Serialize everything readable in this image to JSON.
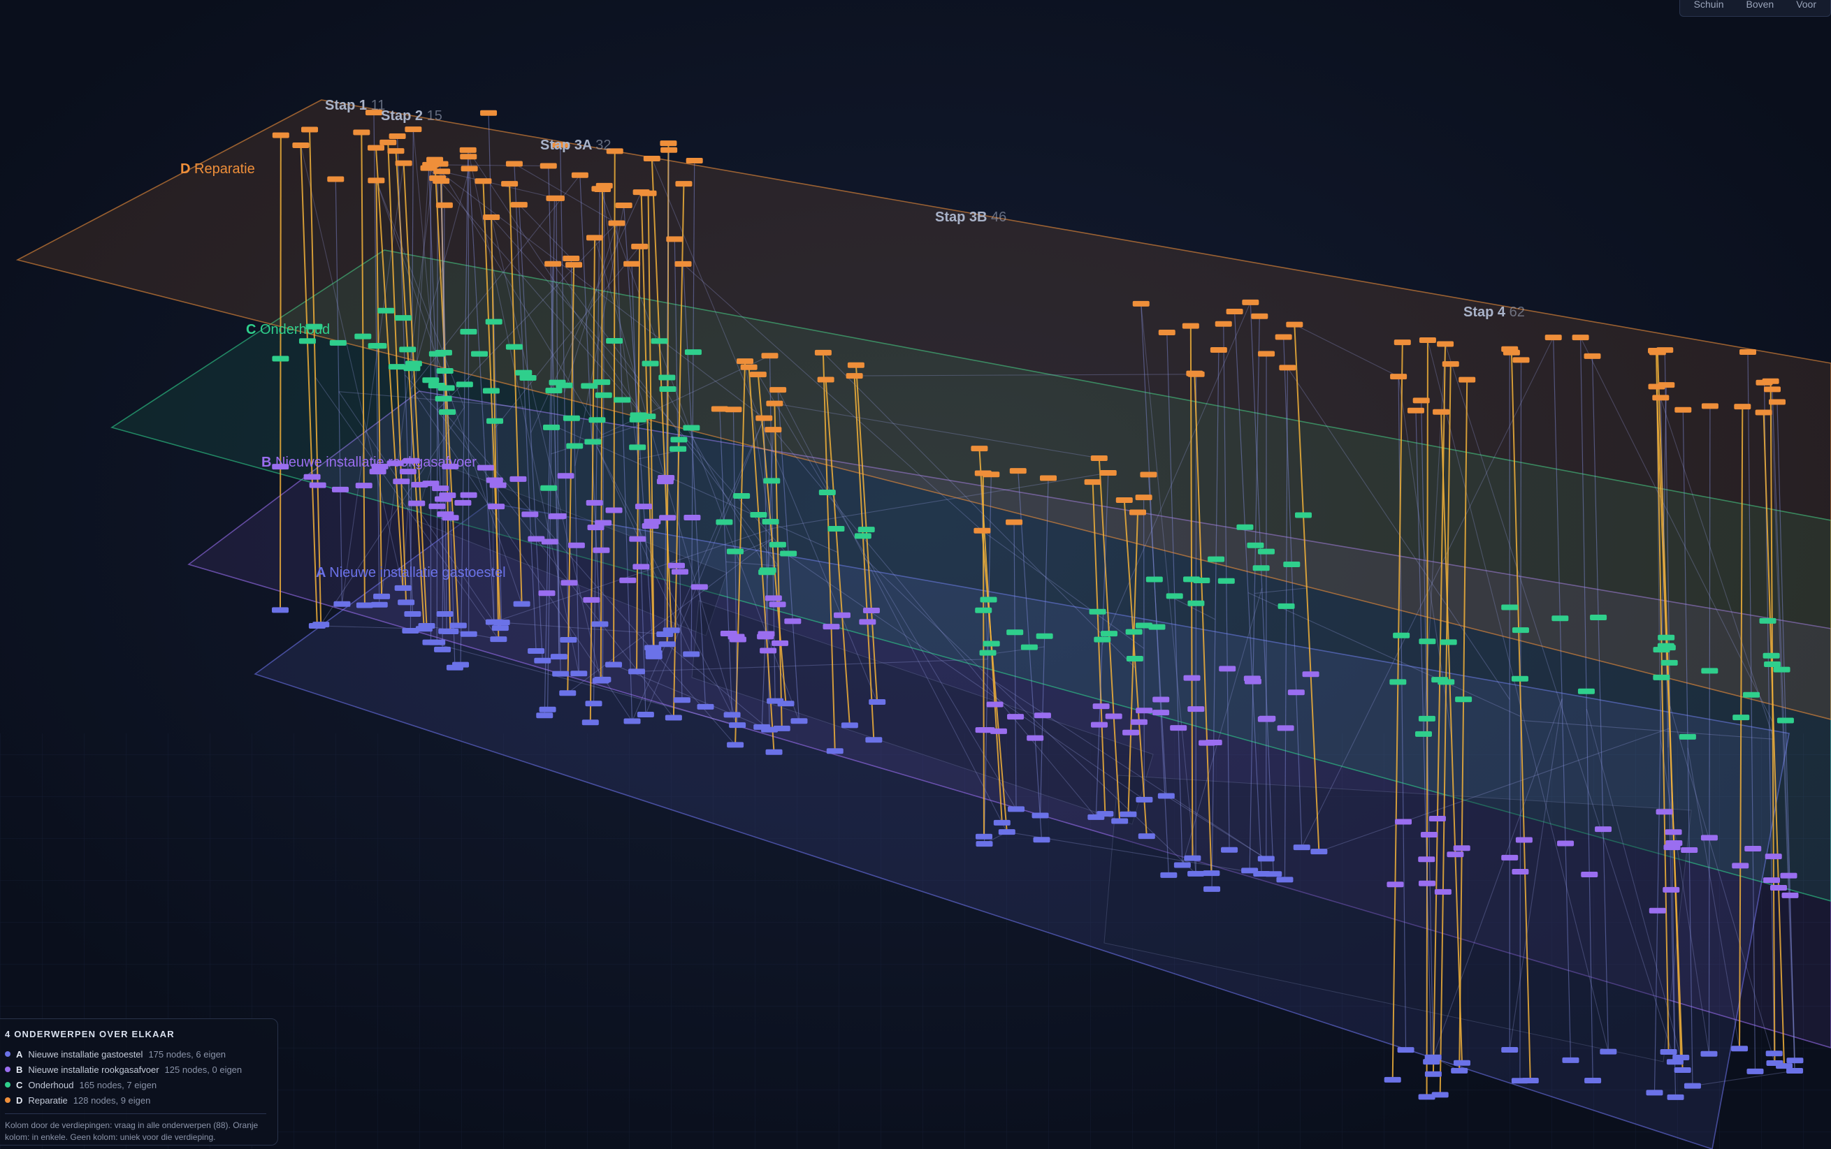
{
  "view_controls": [
    "Schuin",
    "Boven",
    "Voor"
  ],
  "colors": {
    "A": "#6b72e8",
    "B": "#9a6ef0",
    "C": "#2fcf8c",
    "D": "#ef8f3a",
    "stage_label": "#a9b3c9"
  },
  "layers": [
    {
      "letter": "A",
      "name": "Nieuwe installatie gastoestel"
    },
    {
      "letter": "B",
      "name": "Nieuwe installatie rookgasafvoer"
    },
    {
      "letter": "C",
      "name": "Onderhoud"
    },
    {
      "letter": "D",
      "name": "Reparatie"
    }
  ],
  "stages": [
    {
      "name": "Stap 1",
      "count": "11"
    },
    {
      "name": "Stap 2",
      "count": "15"
    },
    {
      "name": "Stap 3A",
      "count": "32"
    },
    {
      "name": "Stap 3B",
      "count": "46"
    },
    {
      "name": "Stap 4",
      "count": "62"
    }
  ],
  "legend": {
    "title": "4 onderwerpen over elkaar",
    "items": [
      {
        "letter": "A",
        "name": "Nieuwe installatie gastoestel",
        "count": "175 nodes, 6 eigen",
        "color": "#6b72e8"
      },
      {
        "letter": "B",
        "name": "Nieuwe installatie rookgasafvoer",
        "count": "125 nodes, 0 eigen",
        "color": "#9a6ef0"
      },
      {
        "letter": "C",
        "name": "Onderhoud",
        "count": "165 nodes, 7 eigen",
        "color": "#2fcf8c"
      },
      {
        "letter": "D",
        "name": "Reparatie",
        "count": "128 nodes, 9 eigen",
        "color": "#ef8f3a"
      }
    ],
    "note": "Kolom door de verdiepingen: vraag in alle onderwerpen (88). Oranje kolom: in enkele. Geen kolom: uniek voor die verdieping."
  }
}
